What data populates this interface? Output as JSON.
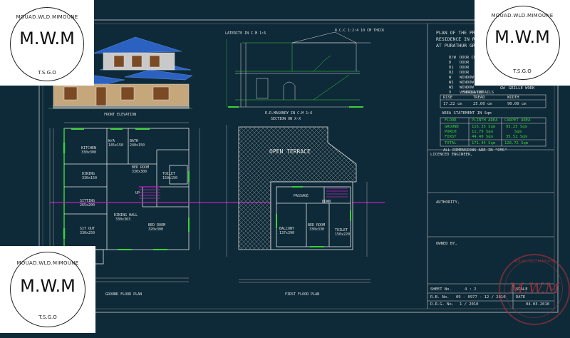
{
  "watermark": {
    "arc_text": "MOUAD.WLD.MIMOUNE",
    "logo": "M.W.M",
    "sub": "T.S.G.O",
    "stamp_logo": "M.W.M",
    "stamp_arc": "MOUAD.WLD.MIMOUNE"
  },
  "drawing_labels": {
    "front_elevation": "FRONT ELEVATION",
    "section_on_xx": "SECTION ON X-X",
    "ground_floor_plan": "GROUND FLOOR PLAN",
    "first_floor_plan": "FIRST FLOOR PLAN",
    "open_terrace": "OPEN TERRACE",
    "laterite": "LATERITE IN C.M 1:6",
    "rcc_note": "R.C.C 1:2:4 10 CM THICK",
    "rr_masonry": "R.R.MASONRY IN C.M 1:6"
  },
  "rooms_gf": [
    {
      "name": "KITCHEN",
      "size": "330x300"
    },
    {
      "name": "W/A",
      "size": "145x150"
    },
    {
      "name": "BATH",
      "size": "240x150"
    },
    {
      "name": "BED ROOM",
      "size": "330x300"
    },
    {
      "name": "DINING",
      "size": "330x150"
    },
    {
      "name": "TOILET",
      "size": "150x150"
    },
    {
      "name": "SITTING",
      "size": "265x200"
    },
    {
      "name": "DINING HALL",
      "size": "330x363"
    },
    {
      "name": "BED ROOM",
      "size": "320x300"
    },
    {
      "name": "SIT OUT",
      "size": "330x250"
    },
    {
      "name": "UP",
      "size": ""
    }
  ],
  "rooms_ff": [
    {
      "name": "PASSAGE",
      "size": ""
    },
    {
      "name": "BALCONY",
      "size": "137x390"
    },
    {
      "name": "BED ROOM",
      "size": "330x330"
    },
    {
      "name": "TOILET",
      "size": "150x220"
    },
    {
      "name": "DOWN",
      "size": ""
    }
  ],
  "title_block": {
    "title_lines": [
      "PLAN OF THE PROPOSED",
      "RESIDENCE IN R.S. NO",
      "AT PURATHUR GRAMA"
    ],
    "legend": [
      {
        "code": "D/W",
        "desc": "DOOR CUM WINDOW"
      },
      {
        "code": "D",
        "desc": "DOOR"
      },
      {
        "code": "D1",
        "desc": "DOOR"
      },
      {
        "code": "D2",
        "desc": "DOOR"
      },
      {
        "code": "W",
        "desc": "WINDOW"
      },
      {
        "code": "W1",
        "desc": "WINDOW"
      },
      {
        "code": "W2",
        "desc": "WINDOW"
      },
      {
        "code": "V",
        "desc": "VENTILATOR"
      },
      {
        "code": "GW",
        "desc": "GRILLE WORK"
      }
    ],
    "stair_title": "STAIR DETAILS",
    "stair_headers": [
      "RISE",
      "TREAD",
      "WIDTH"
    ],
    "stair_values": [
      "17.22 cm",
      "25.00 cm",
      "90.00 cm"
    ],
    "area_title": "AREA STATEMENT IN Sqm",
    "area_headers": [
      "FLOOR",
      "PLINTH AREA",
      "CARPET AREA"
    ],
    "area_rows": [
      [
        "GROUND",
        "115.35 Sqm",
        "93.25 Sqm"
      ],
      [
        "PORCH",
        "11.79 Sqm",
        "Sqm"
      ],
      [
        "FIRST",
        "44.40 Sqm",
        "35.52 Sqm"
      ]
    ],
    "area_total": [
      "TOTAL",
      "171.44 Sqm",
      "128.72 Sqm"
    ],
    "dims_note": "ALL DIMENSIONS ARE IN \"CMS\"",
    "licensed": "LICENCED ENGINEER,",
    "authority": "AUTHORITY,",
    "owned_by": "OWNED BY,",
    "sheet_no_label": "SHEET No.",
    "sheet_no": "4 : 2",
    "rb_label": "R.B. No.",
    "rb_no": "09 - 0977 - 12 / 2010",
    "drg_label": "D.R.G. No.",
    "drg_no": "1 / 2010",
    "scale_label": "SCALE",
    "date_label": "DATE",
    "date_val": "04.03.2010"
  },
  "colors": {
    "background": "#0e2a38",
    "lines": "#e6e6e6",
    "accent_green": "#22d12a",
    "accent_magenta": "#c21fc2",
    "roof_blue": "#2b62c2",
    "stamp_red": "#b8303a"
  }
}
